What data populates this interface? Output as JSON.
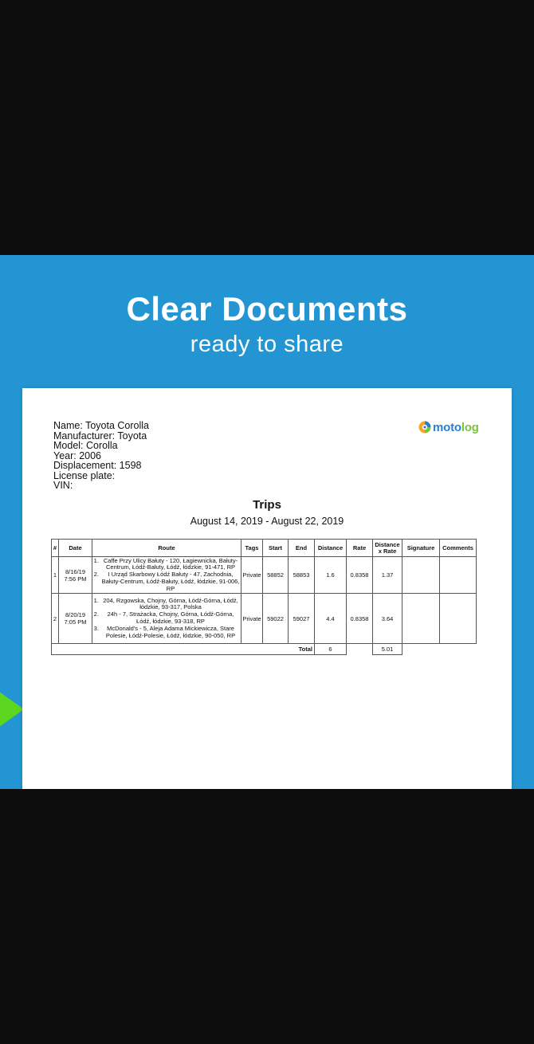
{
  "headline": "Clear Documents",
  "subheadline": "ready to share",
  "logo": {
    "part1": "moto",
    "part2": "log"
  },
  "vehicle": {
    "name": "Name: Toyota Corolla",
    "manufacturer": "Manufacturer: Toyota",
    "model": "Model: Corolla",
    "year": "Year: 2006",
    "displacement": "Displacement: 1598",
    "license_plate": "License plate:",
    "vin": "VIN:"
  },
  "report": {
    "title": "Trips",
    "period": "August 14, 2019 - August 22, 2019"
  },
  "table": {
    "headers": {
      "num": "#",
      "date": "Date",
      "route": "Route",
      "tags": "Tags",
      "start": "Start",
      "end": "End",
      "distance": "Distance",
      "rate": "Rate",
      "dxr_1": "Distance",
      "dxr_2": "x Rate",
      "signature": "Signature",
      "comments": "Comments"
    },
    "rows": [
      {
        "num": "1",
        "date": "8/16/19",
        "time": "7:56 PM",
        "route": [
          "Caffe Przy Ulicy Bałuty - 120, Łagiewnicka, Bałuty-Centrum, Łódź-Bałuty, Łódź, łódzkie, 91-471, RP",
          "I Urząd Skarbowy Łódź Bałuty - 47, Zachodnia, Bałuty-Centrum, Łódź-Bałuty, Łódź, łódzkie, 91-006, RP"
        ],
        "tags": "Private",
        "start": "58852",
        "end": "58853",
        "distance": "1.6",
        "rate": "0.8358",
        "dxr": "1.37",
        "signature": "",
        "comments": ""
      },
      {
        "num": "2",
        "date": "8/20/19",
        "time": "7:05 PM",
        "route": [
          "204, Rzgowska, Chojny, Górna, Łódź-Górna, Łódź, łódzkie, 93-317, Polska",
          "24h - 7, Strażacka, Chojny, Górna, Łódź-Górna, Łódź, łódzkie, 93-318, RP",
          "McDonald's - 5, Aleja Adama Mickiewicza, Stare Polesie, Łódź-Polesie, Łódź, łódzkie, 90-050, RP"
        ],
        "tags": "Private",
        "start": "59022",
        "end": "59027",
        "distance": "4.4",
        "rate": "0.8358",
        "dxr": "3.64",
        "signature": "",
        "comments": ""
      }
    ],
    "total": {
      "label": "Total",
      "distance": "6",
      "dxr": "5.01"
    }
  },
  "colors": {
    "background": "#0d0d0d",
    "banner": "#2495d3",
    "accent_green": "#5cd61e",
    "logo_blue": "#2b7fd0",
    "logo_green": "#7cc242"
  }
}
